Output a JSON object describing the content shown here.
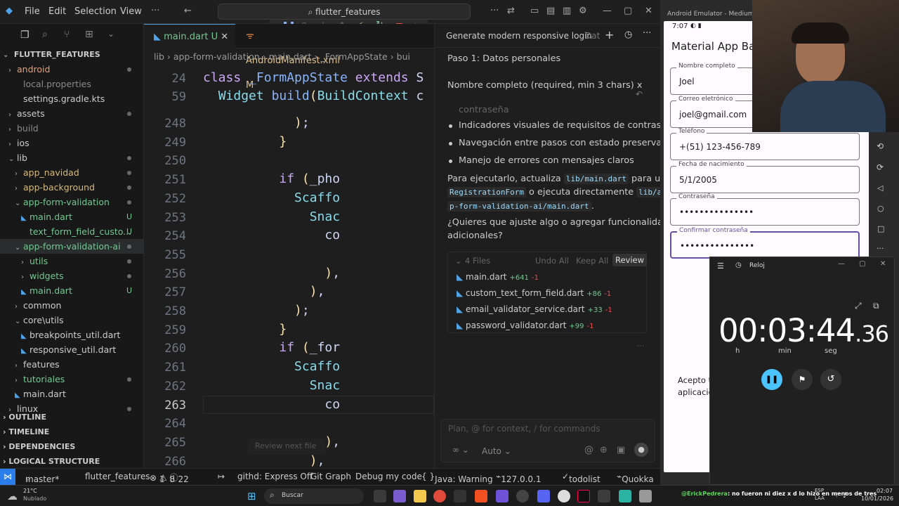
{
  "titlebar": {
    "menus": [
      "File",
      "Edit",
      "Selection",
      "View"
    ],
    "search": "flutter_features"
  },
  "explorer": {
    "root": "FLUTTER_FEATURES",
    "items": [
      {
        "label": "android",
        "indent": 0,
        "chev": "›",
        "color": "#e8a07a",
        "mark": "dot"
      },
      {
        "label": "local.properties",
        "indent": 1,
        "chev": "",
        "color": "#8a8a8a",
        "mark": ""
      },
      {
        "label": "settings.gradle.kts",
        "indent": 1,
        "chev": "",
        "color": "#ccc",
        "mark": ""
      },
      {
        "label": "assets",
        "indent": 0,
        "chev": "›",
        "color": "#ccc",
        "mark": "dot"
      },
      {
        "label": "build",
        "indent": 0,
        "chev": "›",
        "color": "#8a8a8a",
        "mark": ""
      },
      {
        "label": "ios",
        "indent": 0,
        "chev": "›",
        "color": "#ccc",
        "mark": ""
      },
      {
        "label": "lib",
        "indent": 0,
        "chev": "⌄",
        "color": "#ccc",
        "mark": "dot"
      },
      {
        "label": "app_navidad",
        "indent": 1,
        "chev": "›",
        "color": "#d7ba7d",
        "mark": "dot"
      },
      {
        "label": "app-background",
        "indent": 1,
        "chev": "›",
        "color": "#d7ba7d",
        "mark": "dot"
      },
      {
        "label": "app-form-validation",
        "indent": 1,
        "chev": "⌄",
        "color": "#73c991",
        "mark": "dot"
      },
      {
        "label": "main.dart",
        "indent": 2,
        "chev": "",
        "color": "#73c991",
        "mark": "U"
      },
      {
        "label": "text_form_field_custo...",
        "indent": 2,
        "chev": "",
        "color": "#73c991",
        "mark": "U"
      },
      {
        "label": "app-form-validation-ai",
        "indent": 1,
        "chev": "⌄",
        "color": "#73c991",
        "mark": "dot"
      },
      {
        "label": "utils",
        "indent": 2,
        "chev": "›",
        "color": "#73c991",
        "mark": "dot"
      },
      {
        "label": "widgets",
        "indent": 2,
        "chev": "›",
        "color": "#73c991",
        "mark": "dot"
      },
      {
        "label": "main.dart",
        "indent": 2,
        "chev": "",
        "color": "#73c991",
        "mark": "U"
      },
      {
        "label": "common",
        "indent": 1,
        "chev": "›",
        "color": "#ccc",
        "mark": ""
      },
      {
        "label": "core\\utils",
        "indent": 1,
        "chev": "⌄",
        "color": "#ccc",
        "mark": ""
      },
      {
        "label": "breakpoints_util.dart",
        "indent": 2,
        "chev": "",
        "color": "#ccc",
        "mark": ""
      },
      {
        "label": "responsive_util.dart",
        "indent": 2,
        "chev": "",
        "color": "#ccc",
        "mark": ""
      },
      {
        "label": "features",
        "indent": 1,
        "chev": "›",
        "color": "#ccc",
        "mark": ""
      },
      {
        "label": "tutoriales",
        "indent": 1,
        "chev": "›",
        "color": "#73c991",
        "mark": "dot"
      },
      {
        "label": "main.dart",
        "indent": 1,
        "chev": "",
        "color": "#ccc",
        "mark": ""
      },
      {
        "label": "linux",
        "indent": 0,
        "chev": "›",
        "color": "#ccc",
        "mark": "dot"
      }
    ],
    "sections": [
      "OUTLINE",
      "TIMELINE",
      "DEPENDENCIES",
      "LOGICAL STRUCTURE"
    ]
  },
  "editor": {
    "tabs": [
      {
        "label": "main.dart",
        "badge": "U"
      },
      {
        "label": "AndroidManifest.xml",
        "badge": "M"
      }
    ],
    "breadcrumb": "lib › app-form-validation › main.dart › _FormAppState › bui",
    "sticky": [
      {
        "ln": "24",
        "code": "class _FormAppState extends S"
      },
      {
        "ln": "59",
        "code": "  Widget build(BuildContext c"
      }
    ],
    "lines": [
      {
        "ln": "248",
        "code": "            );"
      },
      {
        "ln": "249",
        "code": "          }"
      },
      {
        "ln": "250",
        "code": ""
      },
      {
        "ln": "251",
        "code": "          if (_pho"
      },
      {
        "ln": "252",
        "code": "            Scaffo"
      },
      {
        "ln": "253",
        "code": "              Snac"
      },
      {
        "ln": "254",
        "code": "                co"
      },
      {
        "ln": "255",
        "code": ""
      },
      {
        "ln": "256",
        "code": "                ),"
      },
      {
        "ln": "257",
        "code": "              ),"
      },
      {
        "ln": "258",
        "code": "            );"
      },
      {
        "ln": "259",
        "code": "          }"
      },
      {
        "ln": "260",
        "code": "          if (_for"
      },
      {
        "ln": "261",
        "code": "            Scaffo"
      },
      {
        "ln": "262",
        "code": "              Snac"
      },
      {
        "ln": "263",
        "code": "                co"
      },
      {
        "ln": "264",
        "code": ""
      },
      {
        "ln": "265",
        "code": "                ),"
      },
      {
        "ln": "266",
        "code": "              ),"
      }
    ],
    "review_next": "Review next file"
  },
  "chat": {
    "tab_title": "Generate modern responsive login",
    "tab2": "Dat",
    "heading": "Paso 1: Datos personales",
    "subheading": "Nombre completo (required, min 3 chars) x",
    "faded": "contraseña",
    "bullets": [
      "Indicadores visuales de requisitos de contraseña",
      "Navegación entre pasos con estado preservado",
      "Manejo de errores con mensajes claros"
    ],
    "run1": "Para ejecutarlo, actualiza",
    "code1": "lib/main.dart",
    "run2": "para usar",
    "code2": "RegistrationForm",
    "run3": "o ejecuta directamente",
    "code3": "lib/ap",
    "code4": "p-form-validation-ai/main.dart",
    "run4": ".",
    "question1": "¿Quieres que ajuste algo o agregar funcionalidades",
    "question2": "adicionales?",
    "files_count": "4 Files",
    "undo_all": "Undo All",
    "keep_all": "Keep All",
    "review": "Review",
    "files": [
      {
        "name": "main.dart",
        "add": "+641",
        "del": "-1"
      },
      {
        "name": "custom_text_form_field.dart",
        "add": "+86",
        "del": "-1"
      },
      {
        "name": "email_validator_service.dart",
        "add": "+33",
        "del": "-1"
      },
      {
        "name": "password_validator.dart",
        "add": "+99",
        "del": "-1"
      }
    ],
    "input_placeholder": "Plan, @ for context, / for commands",
    "mode": "Auto"
  },
  "status": {
    "branch": "master*",
    "project": "flutter_features",
    "errors": "1",
    "warnings": "8",
    "info": "22",
    "githd": "githd: Express Off",
    "gitgraph": "Git Graph",
    "debug": "Debug my code",
    "java": "Java: Warning",
    "ip": "127.0.0.1",
    "todo": "todolist",
    "quokka": "Quokka"
  },
  "emulator": {
    "window_title": "Android Emulator - Medium_Phon",
    "time": "7:07",
    "appbar": "Material App Bar",
    "fields": [
      {
        "label": "Nombre completo",
        "value": "Joel"
      },
      {
        "label": "Correo eletrónico",
        "value": "joel@gmail.com"
      },
      {
        "label": "Teléfono",
        "value": "+(51) 123-456-789"
      },
      {
        "label": "Fecha de nacimiento",
        "value": "5/1/2005"
      },
      {
        "label": "Contraseña",
        "value": "•••••••••••••••"
      },
      {
        "label": "Confirmar contraseña",
        "value": "•••••••••••••••"
      }
    ],
    "accept1": "Acepto t",
    "accept2": "aplicació"
  },
  "clock": {
    "title": "Reloj",
    "hours": "00",
    "minutes": "03",
    "seconds": "44",
    "hundredths": ".36",
    "lbl_h": "h",
    "lbl_min": "min",
    "lbl_seg": "seg"
  },
  "taskbar": {
    "temp": "21°C",
    "weather": "Nublado",
    "search": "Buscar",
    "chat_user": "@ErickPedrera",
    "chat_msg": ": no fueron ni diez x d lo hizo en menos de tres",
    "lang": "ESP",
    "lang2": "LAA",
    "time": "02:07",
    "date": "10/01/2026"
  }
}
